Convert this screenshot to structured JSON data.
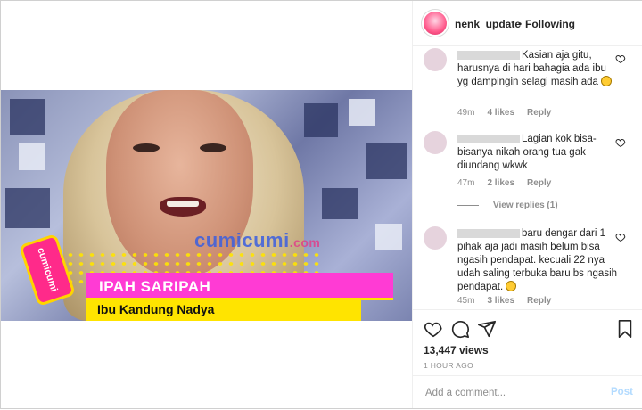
{
  "header": {
    "username": "nenk_update",
    "separator": "•",
    "follow_status": "Following"
  },
  "video": {
    "watermark": "cumicumi",
    "watermark_tld": ".com",
    "badge_text": "cumicumi",
    "name_title": "IPAH SARIPAH",
    "role_title": "Ibu Kandung Nadya"
  },
  "comments": [
    {
      "text": "Kasian aja gitu, harusnya di hari bahagia ada ibu yg dampingin selagi masih ada",
      "has_emoji": true,
      "time": "49m",
      "likes": "4 likes",
      "reply": "Reply"
    },
    {
      "text": "Lagian kok bisa-bisanya nikah orang tua gak diundang wkwk",
      "time": "47m",
      "likes": "2 likes",
      "reply": "Reply",
      "view_replies": "View replies (1)"
    },
    {
      "text": "baru dengar dari 1 pihak aja jadi masih belum bisa ngasih pendapat. kecuali 22 nya udah saling terbuka baru bs ngasih pendapat.",
      "has_emoji": true,
      "time": "45m",
      "likes": "3 likes",
      "reply": "Reply"
    }
  ],
  "actions": {
    "icons": [
      "heart-icon",
      "comment-icon",
      "share-icon",
      "bookmark-icon"
    ],
    "views": "13,447 views",
    "time": "1 HOUR AGO"
  },
  "add_comment": {
    "placeholder": "Add a comment...",
    "post_label": "Post"
  },
  "colors": {
    "name_bar": "#ff3bd4",
    "role_bar": "#ffe400",
    "post_disabled": "#b3dbff",
    "meta_gray": "#8e8e8e"
  }
}
